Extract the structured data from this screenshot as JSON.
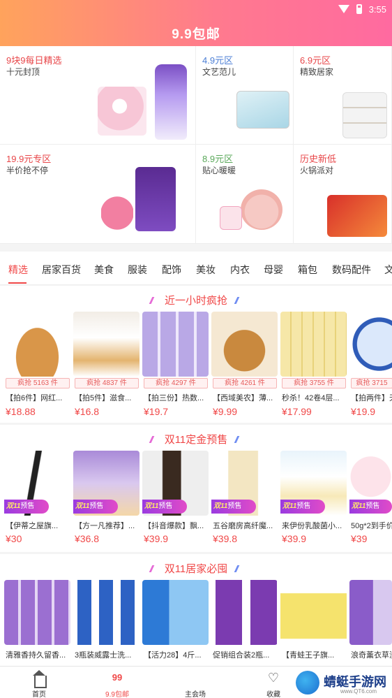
{
  "status": {
    "time": "3:55"
  },
  "header": {
    "logo": "9.9包邮"
  },
  "promo_grid": [
    {
      "title": "9块9每日精选",
      "subtitle": "十元封顶",
      "color": "#e8474a"
    },
    {
      "title": "4.9元区",
      "subtitle": "文艺范儿",
      "color": "#4c7fd6"
    },
    {
      "title": "6.9元区",
      "subtitle": "精致居家",
      "color": "#e8474a"
    },
    {
      "title": "19.9元专区",
      "subtitle": "半价抢不停",
      "color": "#e8474a"
    },
    {
      "title": "8.9元区",
      "subtitle": "贴心暖暖",
      "color": "#5aa85a"
    },
    {
      "title": "历史新低",
      "subtitle": "火锅派对",
      "color": "#e8474a"
    }
  ],
  "tabs": [
    "精选",
    "居家百货",
    "美食",
    "服装",
    "配饰",
    "美妆",
    "内衣",
    "母婴",
    "箱包",
    "数码配件",
    "文"
  ],
  "sections": [
    {
      "title": "近一小时疯抢",
      "products": [
        {
          "sold": "疯抢 5163 件",
          "name": "【拍6件】网红...",
          "price": "¥18.88"
        },
        {
          "sold": "疯抢 4837 件",
          "name": "【拍5件】滋食...",
          "price": "¥16.8"
        },
        {
          "sold": "疯抢 4297 件",
          "name": "【拍三份】热数...",
          "price": "¥19.7"
        },
        {
          "sold": "疯抢 4261 件",
          "name": "【西域美农】薄...",
          "price": "¥9.99"
        },
        {
          "sold": "疯抢 3755 件",
          "name": "秒杀！42卷4层...",
          "price": "¥17.99"
        },
        {
          "sold": "疯抢 3715",
          "name": "【拍两件】天",
          "price": "¥19.9"
        }
      ]
    },
    {
      "title": "双11定金预售",
      "badge_main": "双11",
      "badge_tail": "预售",
      "products": [
        {
          "name": "【伊蒂之屋旗...",
          "price": "¥30"
        },
        {
          "name": "【方一凡推荐】...",
          "price": "¥36.8"
        },
        {
          "name": "【抖音爆款】飘...",
          "price": "¥39.9"
        },
        {
          "name": "五谷磨房高纤魔...",
          "price": "¥39.8"
        },
        {
          "name": "来伊份乳酸菌小...",
          "price": "¥39.9"
        },
        {
          "name": "50g*2到手价",
          "price": "¥39"
        }
      ]
    },
    {
      "title": "双11居家必囤",
      "products": [
        {
          "name": "清雅香持久留香..."
        },
        {
          "name": "3瓶装威露士洗..."
        },
        {
          "name": "【活力28】4斤..."
        },
        {
          "name": "促销组合装2瓶..."
        },
        {
          "name": "【青蛙王子旗..."
        },
        {
          "name": "浪奇薰衣草洗"
        }
      ]
    }
  ],
  "bottom_nav": [
    {
      "label": "首页",
      "icon": "home-icon"
    },
    {
      "label": "9.9包邮",
      "icon": "99-icon"
    },
    {
      "label": "主会场",
      "icon": ""
    },
    {
      "label": "收藏",
      "icon": "heart-icon"
    }
  ],
  "watermark": {
    "text": "蜻蜓手游网",
    "sub": "www.QT6.com"
  }
}
